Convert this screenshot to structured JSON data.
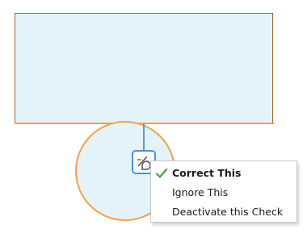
{
  "menu": {
    "items": [
      {
        "label": "Correct This",
        "checked": true,
        "bold": true
      },
      {
        "label": "Ignore This",
        "checked": false,
        "bold": false
      },
      {
        "label": "Deactivate this Check",
        "checked": false,
        "bold": false
      }
    ]
  },
  "icons": {
    "check_button": "quick-fix-icon",
    "selected_mark": "checkmark-icon"
  },
  "colors": {
    "shape_fill": "#e4f3f9",
    "rect_border": "#a06a22",
    "circle_border": "#f5a04a",
    "accent_blue": "#4a90d9",
    "check_green": "#3aa835"
  }
}
